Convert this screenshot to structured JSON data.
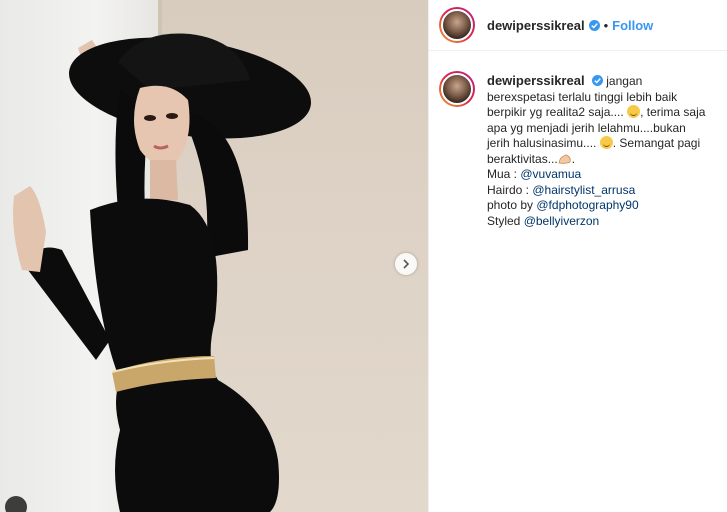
{
  "post": {
    "username": "dewiperssikreal",
    "follow_label": "Follow",
    "separator": "•"
  },
  "caption": {
    "username": "dewiperssikreal",
    "line1": "jangan berexspetasi terlalu tinggi lebih baik berpikir yg realita2 saja....",
    "line2": ", terima saja apa yg menjadi jerih lelahmu....bukan jerih halusinasimu....",
    "line3": ". Semangat pagi beraktivitas...",
    "line3_end": ".",
    "mua_label": "Mua : ",
    "mua_handle": "@vuvamua",
    "hairdo_label": "Hairdo : ",
    "hairdo_handle": "@hairstylist_arrusa",
    "photo_label": "photo by ",
    "photo_handle": "@fdphotography90",
    "styled_label": "Styled ",
    "styled_handle": "@bellyiverzon"
  },
  "icons": {
    "verified": "verified-badge-icon",
    "next": "chevron-right-icon",
    "emoji": "smiling-face-icon",
    "muscle": "flexed-biceps-icon"
  },
  "colors": {
    "accent": "#3897f0",
    "mention": "#003569",
    "dress": "#0c0c0c",
    "belt": "#c9a76a"
  }
}
